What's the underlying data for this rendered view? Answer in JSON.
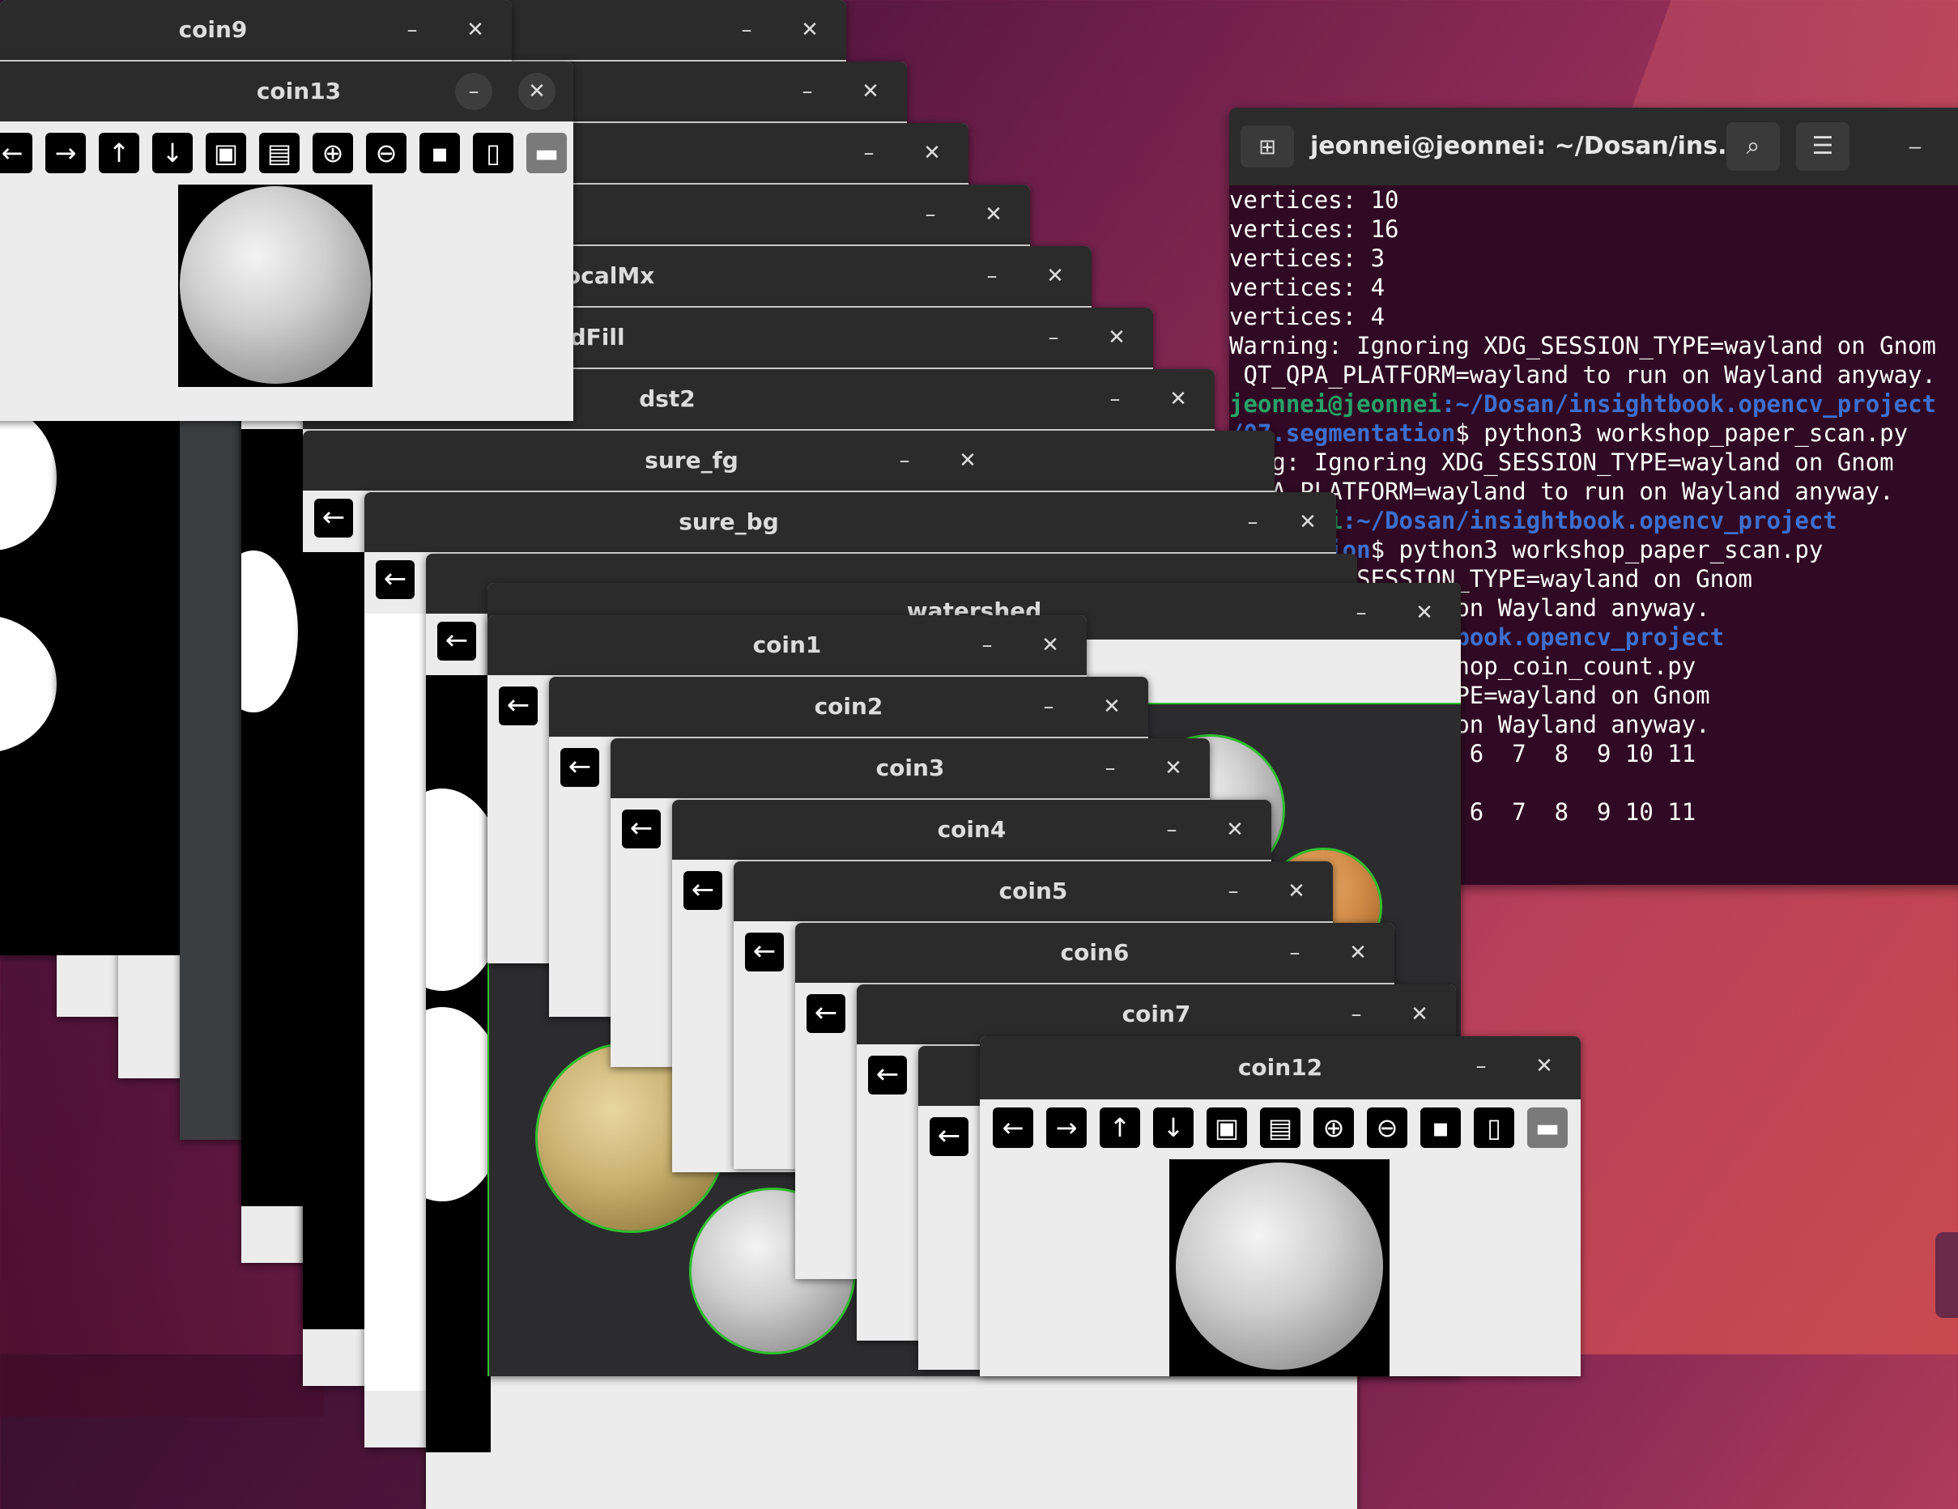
{
  "desktop": {
    "accent": "#c94a4e"
  },
  "windows": {
    "coin9": {
      "title": "coin9"
    },
    "coin13": {
      "title": "coin13"
    },
    "partial_a": {
      "title": ""
    },
    "partial_b": {
      "title": ""
    },
    "partial_c": {
      "title": ""
    },
    "localmx": {
      "title": "ocalMx"
    },
    "floodfill": {
      "title": "floodFill"
    },
    "dst2": {
      "title": "dst2"
    },
    "sure_fg": {
      "title": "sure_fg"
    },
    "sure_bg": {
      "title": "sure_bg"
    },
    "watershed": {
      "title": "watershed"
    },
    "coin1": {
      "title": "coin1"
    },
    "coin2": {
      "title": "coin2"
    },
    "coin3": {
      "title": "coin3"
    },
    "coin4": {
      "title": "coin4"
    },
    "coin5": {
      "title": "coin5"
    },
    "coin6": {
      "title": "coin6"
    },
    "coin7": {
      "title": "coin7"
    },
    "coin12": {
      "title": "coin12"
    }
  },
  "window_controls": {
    "minimize": "–",
    "close": "✕",
    "back": "←"
  },
  "toolbar_icons": [
    "arrow-left-icon",
    "arrow-right-icon",
    "arrow-up-icon",
    "arrow-down-icon",
    "image-icon",
    "image-edit-icon",
    "zoom-in-icon",
    "zoom-out-icon",
    "save-icon",
    "clipboard-icon",
    "paint-roller-icon"
  ],
  "toolbar_glyphs": [
    "←",
    "→",
    "↑",
    "↓",
    "▣",
    "▤",
    "⊕",
    "⊖",
    "▪",
    "▯",
    "▬"
  ],
  "terminal": {
    "title": "jeonnei@jeonnei: ~/Dosan/ins...",
    "lines": [
      {
        "text": "vertices: 10"
      },
      {
        "text": "vertices: 16"
      },
      {
        "text": "vertices: 3"
      },
      {
        "text": "vertices: 4"
      },
      {
        "text": "vertices: 4"
      },
      {
        "text": "Warning: Ignoring XDG_SESSION_TYPE=wayland on Gnom"
      },
      {
        "text": " QT_QPA_PLATFORM=wayland to run on Wayland anyway."
      },
      {
        "user": "jeonnei@jeonnei",
        "path": ":~/Dosan/insightbook.opencv_project"
      },
      {
        "path": "/07.segmentation",
        "text": "$ python3 workshop_paper_scan.py"
      },
      {
        "text": "ning: Ignoring XDG_SESSION_TYPE=wayland on Gnom"
      },
      {
        "text": "_QPA_PLATFORM=wayland to run on Wayland anyway."
      },
      {
        "user": "@jeonnei",
        "path": ":~/Dosan/insightbook.opencv_project"
      },
      {
        "path": "gmentation",
        "text": "$ python3 workshop_paper_scan.py"
      },
      {
        "text": "ring XDG_SESSION_TYPE=wayland on Gnom"
      },
      {
        "text": "=wayland to run on Wayland anyway."
      },
      {
        "path": ":~/Dosan/insightbook.opencv_project"
      },
      {
        "path": "n",
        "text": "$ python3 workshop_coin_count.py"
      },
      {
        "text": "g XDG_SESSION_TYPE=wayland on Gnom"
      },
      {
        "text": "=wayland to run on Wayland anyway."
      },
      {
        "text": "  1  2  3  4  5  6  7  8  9 10 11"
      },
      {
        "text": ""
      },
      {
        "text": "  1  2  3  4  5  6  7  8  9 10 11"
      }
    ]
  }
}
